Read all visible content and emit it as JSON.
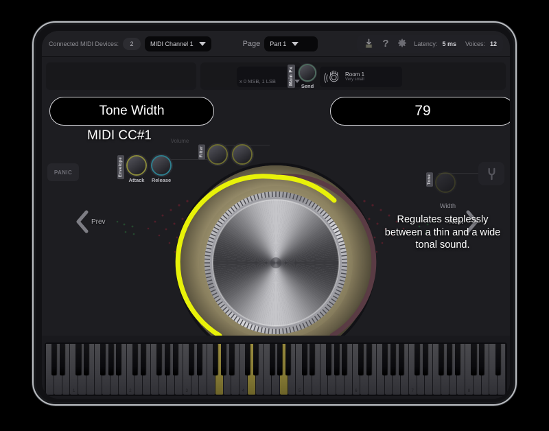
{
  "app": {
    "toolbar": {
      "connected_label": "Connected MIDI Devices:",
      "connected_count": "2",
      "midi_channel": "MIDI Channel 1",
      "page_label": "Page",
      "page_value": "Part 1",
      "icons": [
        "save-icon",
        "help-icon",
        "settings-gear-icon"
      ],
      "latency_label": "Latency:",
      "latency_value": "5 ms",
      "voices_label": "Voices:",
      "voices_value": "12"
    },
    "overlay": {
      "parameter_title": "Tone Width",
      "parameter_value": "79",
      "midi_cc": "MIDI CC#1",
      "description": "Regulates steplessly between a thin and a wide tonal sound."
    },
    "nav": {
      "prev": "Prev",
      "next": "Next"
    },
    "panels": {
      "panic": "PANIC",
      "envelope_tag": "Envelope",
      "envelope_knobs": [
        "Attack",
        "Release"
      ],
      "volume_label": "Volume",
      "filter_tag": "Filter",
      "tone_tag": "Tone",
      "tone_width_label": "Width",
      "mainfx_tag": "Main Fx",
      "send_label": "Send",
      "fx_preset_name": "Room 1",
      "fx_preset_sub": "Very small",
      "midi_binding": "x 0 MSB, 1 LSB",
      "tuning_fork": "tuning-fork-icon",
      "transpose_button": "arrow-right-icon"
    },
    "knob": {
      "value_percent": 79,
      "arc_color": "#e8f209",
      "track_color": "#5a3b44",
      "bezel_color": "#a09574"
    },
    "keyboard": {
      "octave_markers": [
        "1",
        "2",
        "3",
        "4",
        "5",
        "6",
        "7",
        "8"
      ],
      "highlighted_white_keys": [
        21,
        25,
        29
      ],
      "white_key_count": 57
    },
    "colors": {
      "screen_bg": "#1d1d21",
      "toolbar_bg": "#202024",
      "accent_yellow": "#e8f209",
      "bezel": "#b9bcc0"
    }
  }
}
